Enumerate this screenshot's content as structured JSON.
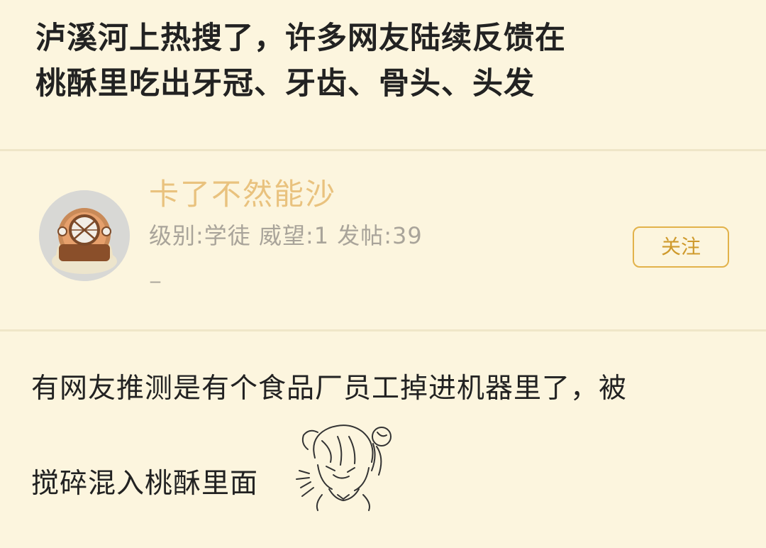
{
  "post": {
    "title_line1": "泸溪河上热搜了，许多网友陆续反馈在",
    "title_line2": "桃酥里吃出牙冠、牙齿、骨头、头发"
  },
  "author": {
    "name": "卡了不然能沙",
    "stats": "级别:学徒 威望:1 发帖:39",
    "signature": "_",
    "follow_label": "关注"
  },
  "content": {
    "line1": "有网友推测是有个食品厂员工掉进机器里了，被",
    "line2": "搅碎混入桃酥里面"
  },
  "colors": {
    "background": "#fcf5de",
    "username": "#e9c27e",
    "follow_border": "#e2b24a",
    "follow_text": "#cf9a2c",
    "meta_text": "#a9a49a"
  },
  "icons": {
    "avatar": "diving-helmet-avatar",
    "sticker": "anime-girl-sneeze-sticker"
  }
}
